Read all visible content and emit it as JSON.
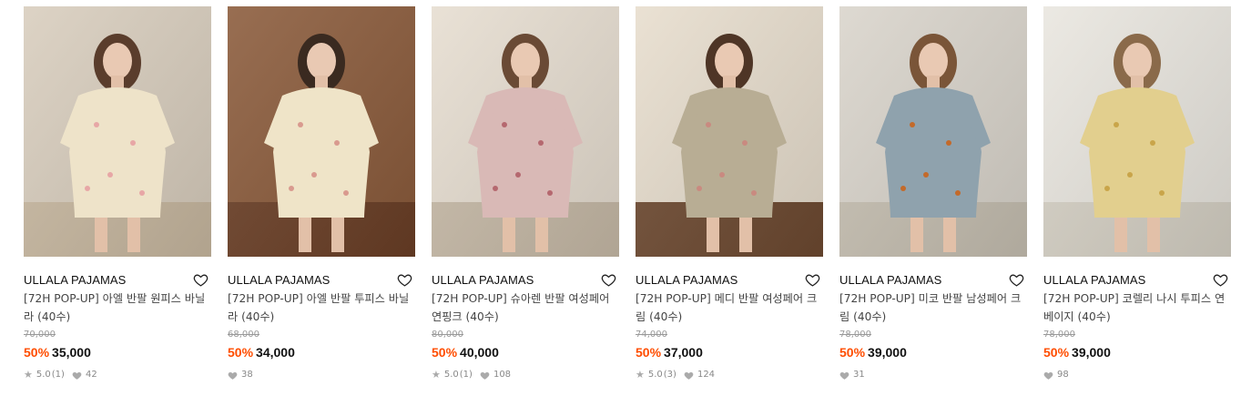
{
  "products": [
    {
      "brand": "ULLALA PAJAMAS",
      "title": "[72H POP-UP] 아엘 반팔 원피스 바닐라 (40수)",
      "original_price": "70,000",
      "discount": "50%",
      "price": "35,000",
      "rating": "5.0",
      "reviews": "(1)",
      "likes": "42",
      "has_rating": true,
      "image": {
        "bg": "#d8cdbd",
        "outfit": "#eee3c9",
        "accent": "#e7a7a6",
        "hair": "#5a3d2c",
        "floor": "#c9b9a1"
      }
    },
    {
      "brand": "ULLALA PAJAMAS",
      "title": "[72H POP-UP] 아엘 반팔 투피스 바닐라 (40수)",
      "original_price": "68,000",
      "discount": "50%",
      "price": "34,000",
      "rating": "",
      "reviews": "",
      "likes": "38",
      "has_rating": false,
      "image": {
        "bg": "#8a5a3a",
        "outfit": "#efe4c8",
        "accent": "#d99a8f",
        "hair": "#3a2a20",
        "floor": "#6b3f26"
      }
    },
    {
      "brand": "ULLALA PAJAMAS",
      "title": "[72H POP-UP] 슈아렌 반팔 여성페어 연핑크 (40수)",
      "original_price": "80,000",
      "discount": "50%",
      "price": "40,000",
      "rating": "5.0",
      "reviews": "(1)",
      "likes": "108",
      "has_rating": true,
      "image": {
        "bg": "#e6ddd0",
        "outfit": "#d9b9b6",
        "accent": "#b5686f",
        "hair": "#6a4a35",
        "floor": "#c8bba8"
      }
    },
    {
      "brand": "ULLALA PAJAMAS",
      "title": "[72H POP-UP] 메디 반팔 여성페어 크림 (40수)",
      "original_price": "74,000",
      "discount": "50%",
      "price": "37,000",
      "rating": "5.0",
      "reviews": "(3)",
      "likes": "124",
      "has_rating": true,
      "image": {
        "bg": "#e7ddcd",
        "outfit": "#b8ad94",
        "accent": "#c98a80",
        "hair": "#4e3526",
        "floor": "#6e4a31"
      }
    },
    {
      "brand": "ULLALA PAJAMAS",
      "title": "[72H POP-UP] 미코 반팔 남성페어 크림 (40수)",
      "original_price": "78,000",
      "discount": "50%",
      "price": "39,000",
      "rating": "",
      "reviews": "",
      "likes": "31",
      "has_rating": false,
      "image": {
        "bg": "#d9d4cb",
        "outfit": "#8fa2ad",
        "accent": "#c36a2a",
        "hair": "#7a5538",
        "floor": "#c7c0b2"
      }
    },
    {
      "brand": "ULLALA PAJAMAS",
      "title": "[72H POP-UP] 코렐리 나시 투피스 연베이지 (40수)",
      "original_price": "78,000",
      "discount": "50%",
      "price": "39,000",
      "rating": "",
      "reviews": "",
      "likes": "98",
      "has_rating": false,
      "image": {
        "bg": "#e9e6df",
        "outfit": "#e2cf8e",
        "accent": "#c9a54a",
        "hair": "#8a6a4a",
        "floor": "#d7d2c6"
      }
    }
  ]
}
